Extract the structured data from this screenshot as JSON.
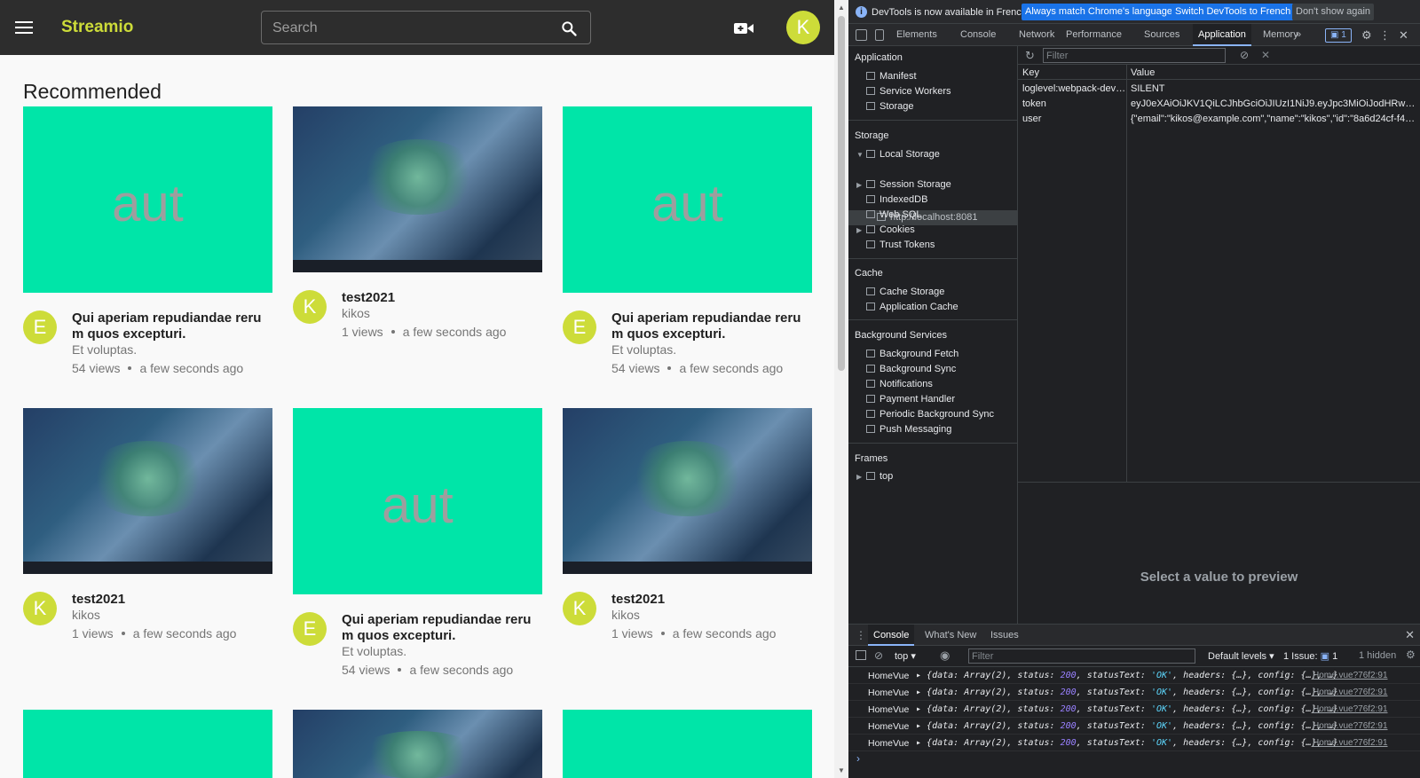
{
  "app": {
    "brand": "Streamio",
    "search_placeholder": "Search",
    "user_initial": "K",
    "section_title": "Recommended",
    "colors": {
      "accent": "#cddc39",
      "thumb_bg": "#00e5a8",
      "topbar": "#2d2d2d"
    },
    "videos": [
      {
        "thumb_type": "text",
        "thumb_text": "aut",
        "channel_initial": "E",
        "title": "Qui aperiam repudiandae reru m quos excepturi.",
        "channel": "Et voluptas.",
        "views": "54 views",
        "time": "a few seconds ago"
      },
      {
        "thumb_type": "game",
        "thumb_text": "",
        "channel_initial": "K",
        "title": "test2021",
        "channel": "kikos",
        "views": "1 views",
        "time": "a few seconds ago"
      },
      {
        "thumb_type": "text",
        "thumb_text": "aut",
        "channel_initial": "E",
        "title": "Qui aperiam repudiandae reru m quos excepturi.",
        "channel": "Et voluptas.",
        "views": "54 views",
        "time": "a few seconds ago"
      },
      {
        "thumb_type": "game",
        "thumb_text": "",
        "channel_initial": "K",
        "title": "test2021",
        "channel": "kikos",
        "views": "1 views",
        "time": "a few seconds ago"
      },
      {
        "thumb_type": "text",
        "thumb_text": "aut",
        "channel_initial": "E",
        "title": "Qui aperiam repudiandae reru m quos excepturi.",
        "channel": "Et voluptas.",
        "views": "54 views",
        "time": "a few seconds ago"
      },
      {
        "thumb_type": "game",
        "thumb_text": "",
        "channel_initial": "K",
        "title": "test2021",
        "channel": "kikos",
        "views": "1 views",
        "time": "a few seconds ago"
      }
    ]
  },
  "devtools": {
    "infobar": {
      "text": "DevTools is now available in French!",
      "btn_match": "Always match Chrome's language",
      "btn_switch": "Switch DevTools to French",
      "btn_dismiss": "Don't show again"
    },
    "tabs": [
      "Elements",
      "Console",
      "Network",
      "Performance",
      "Sources",
      "Application",
      "Memory"
    ],
    "active_tab": "Application",
    "more_tabs": "»",
    "issues_count": "1",
    "sidebar": {
      "application_header": "Application",
      "application_items": [
        "Manifest",
        "Service Workers",
        "Storage"
      ],
      "storage_header": "Storage",
      "local_storage": "Local Storage",
      "local_storage_origin": "http://localhost:8081",
      "storage_items": [
        "Session Storage",
        "IndexedDB",
        "Web SQL",
        "Cookies",
        "Trust Tokens"
      ],
      "cache_header": "Cache",
      "cache_items": [
        "Cache Storage",
        "Application Cache"
      ],
      "bg_header": "Background Services",
      "bg_items": [
        "Background Fetch",
        "Background Sync",
        "Notifications",
        "Payment Handler",
        "Periodic Background Sync",
        "Push Messaging"
      ],
      "frames_header": "Frames",
      "frames_top": "top"
    },
    "storage_table": {
      "filter_placeholder": "Filter",
      "col_key": "Key",
      "col_value": "Value",
      "rows": [
        {
          "key": "loglevel:webpack-dev-s...",
          "value": "SILENT"
        },
        {
          "key": "token",
          "value": "eyJ0eXAiOiJKV1QiLCJhbGciOiJIUzI1NiJ9.eyJpc3MiOiJodHRwOi8vXC..."
        },
        {
          "key": "user",
          "value": "{\"email\":\"kikos@example.com\",\"name\":\"kikos\",\"id\":\"8a6d24cf-f4e1-..."
        }
      ],
      "preview_text": "Select a value to preview"
    },
    "drawer": {
      "tabs": [
        "Console",
        "What's New",
        "Issues"
      ],
      "active_tab": "Console",
      "context": "top",
      "filter_placeholder": "Filter",
      "levels": "Default levels",
      "issue_label": "1 Issue:",
      "issue_count": "1",
      "hidden": "1 hidden",
      "logs": [
        {
          "source": "HomeVue",
          "link": "Home.vue?76f2:91"
        },
        {
          "source": "HomeVue",
          "link": "Home.vue?76f2:91"
        },
        {
          "source": "HomeVue",
          "link": "Home.vue?76f2:91"
        },
        {
          "source": "HomeVue",
          "link": "Home.vue?76f2:91"
        },
        {
          "source": "HomeVue",
          "link": "Home.vue?76f2:91"
        }
      ],
      "log_message": {
        "data": "data",
        "array": "Array(2)",
        "status": "status",
        "status_val": "200",
        "statusText": "statusText",
        "statusText_val": "'OK'",
        "headers": "headers",
        "config": "config",
        "ellipsis": "{…}"
      }
    }
  }
}
